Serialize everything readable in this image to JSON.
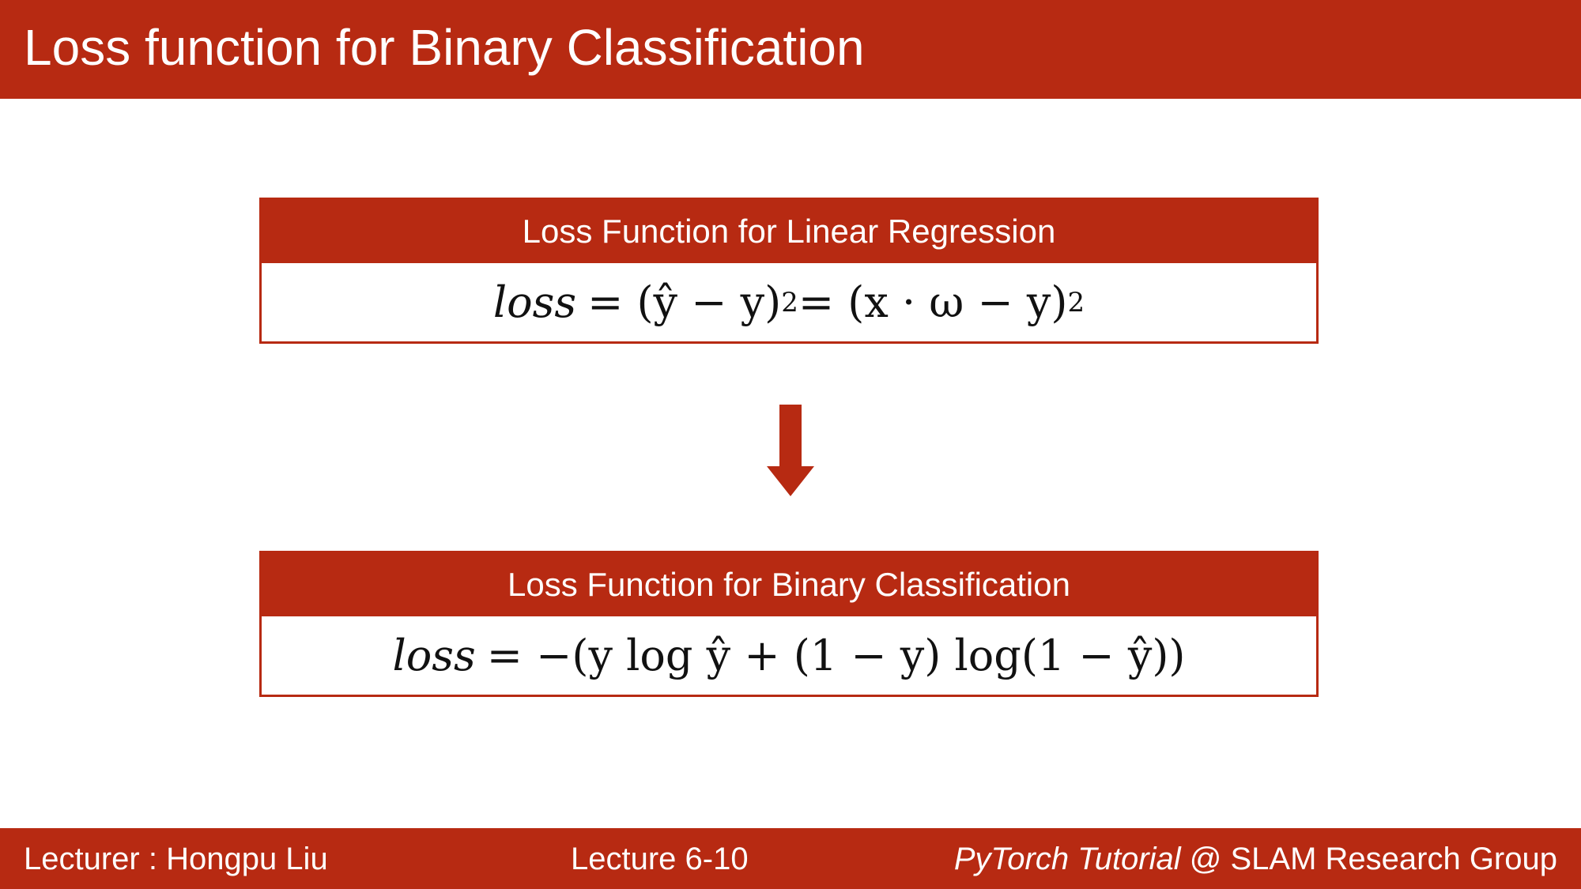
{
  "header": {
    "title": "Loss function for Binary Classification"
  },
  "boxes": [
    {
      "title": "Loss Function for Linear Regression",
      "formula": {
        "lhs": "loss",
        "part1": "= (ŷ − y)",
        "exp1": "2",
        "part2": "= (x · ω − y)",
        "exp2": "2"
      }
    },
    {
      "title": "Loss Function for Binary Classification",
      "formula": {
        "lhs": "loss",
        "rhs": "= −(y log ŷ + (1 − y) log(1 − ŷ))"
      }
    }
  ],
  "arrow_icon": "arrow-down-icon",
  "footer": {
    "lecturer": "Lecturer : Hongpu Liu",
    "lecture": "Lecture 6-10",
    "course_italic": "PyTorch Tutorial",
    "course_rest": " @ SLAM Research Group"
  },
  "colors": {
    "accent": "#b72a12",
    "background": "#ffffff",
    "text_on_accent": "#ffffff"
  }
}
